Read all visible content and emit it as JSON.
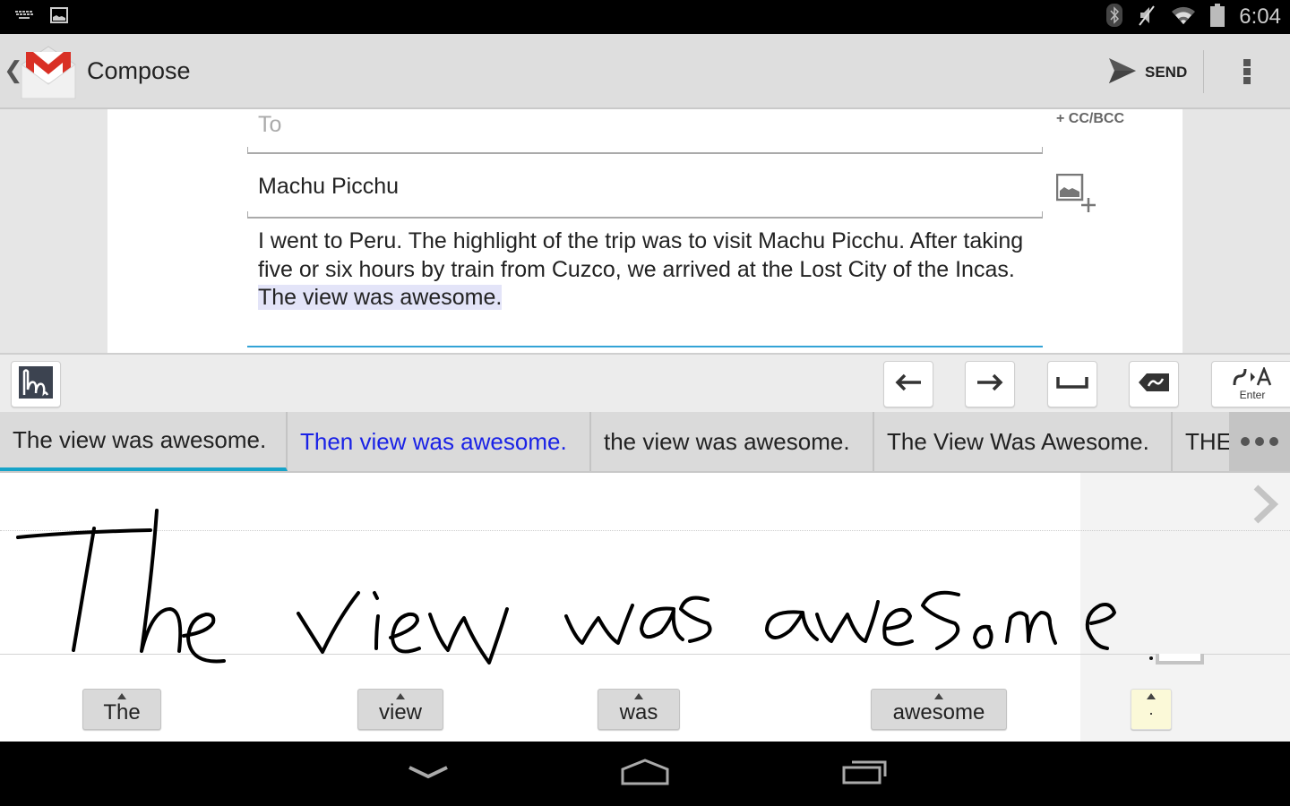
{
  "status_bar": {
    "time": "6:04",
    "left_icons": [
      "keyboard-icon",
      "image-icon"
    ],
    "right_icons": [
      "bluetooth-icon",
      "vibrate-silent-icon",
      "wifi-icon",
      "battery-icon"
    ]
  },
  "action_bar": {
    "app_icon": "gmail-icon",
    "title": "Compose",
    "send_label": "SEND",
    "overflow_icon": "overflow-menu-icon"
  },
  "compose": {
    "to_placeholder": "To",
    "to_value": "",
    "cc_bcc_label": "+ CC/BCC",
    "subject": "Machu Picchu",
    "body_text": "I went to Peru. The highlight of the trip was to visit Machu Picchu. After taking five or six hours by train from Cuzco, we arrived at the Lost City of the Incas. ",
    "body_highlight": "The view was awesome.",
    "attach_icon": "add-image-icon"
  },
  "toolbar": {
    "mode_icon": "handwriting-mode-icon",
    "buttons": [
      {
        "name": "cursor-left",
        "icon": "arrow-left-icon"
      },
      {
        "name": "cursor-right",
        "icon": "arrow-right-icon"
      },
      {
        "name": "space",
        "icon": "space-icon"
      },
      {
        "name": "backspace",
        "icon": "backspace-icon"
      },
      {
        "name": "enter",
        "icon": "enter-icon",
        "label": "Enter"
      }
    ]
  },
  "candidates": [
    {
      "text": "The view was awesome.",
      "selected": true
    },
    {
      "text": "Then view was awesome.",
      "selected": false
    },
    {
      "text": "the view was awesome.",
      "selected": false
    },
    {
      "text": "The View Was Awesome.",
      "selected": false
    },
    {
      "text": "THE VIEW WAS AWESOME.",
      "selected": false
    }
  ],
  "writing_area": {
    "ink_text": "The view was awesome",
    "word_chips": [
      "The",
      "view",
      "was",
      "awesome",
      "."
    ]
  },
  "nav_bar": {
    "buttons": [
      "back-icon",
      "home-icon",
      "recent-apps-icon"
    ]
  },
  "colors": {
    "accent": "#16a3c8",
    "alt_candidate": "#1a22e6",
    "selection_highlight": "#e3e4f8",
    "gmail_red": "#d93025"
  }
}
